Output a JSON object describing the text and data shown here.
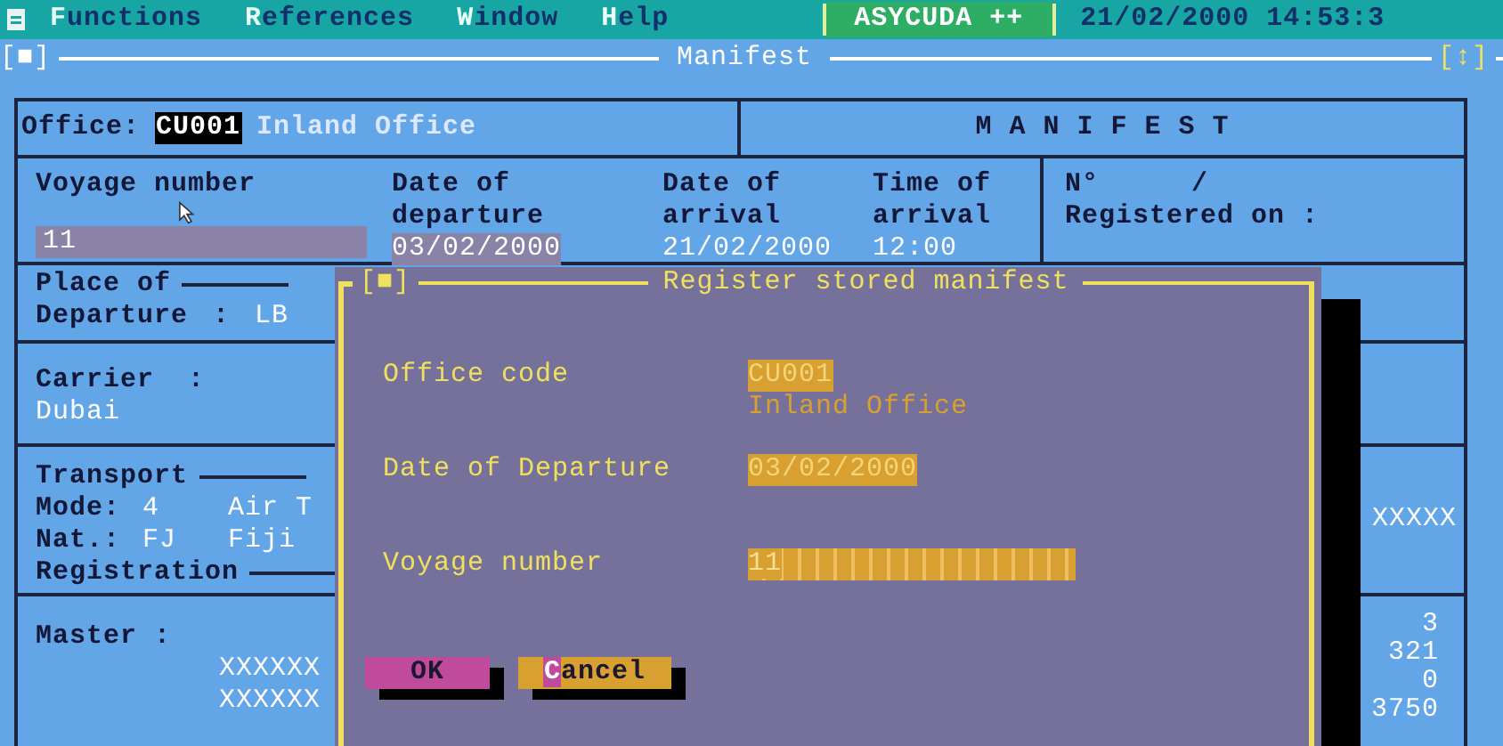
{
  "menu_bar": {
    "items": [
      {
        "label": "Functions"
      },
      {
        "label": "References"
      },
      {
        "label": "Window"
      },
      {
        "label": "Help"
      }
    ],
    "app_name": "ASYCUDA ++",
    "datetime": "21/02/2000 14:53:3"
  },
  "window": {
    "title": "Manifest",
    "left_control": "[■]",
    "right_control": "[↕]"
  },
  "header": {
    "office_label": "Office:",
    "office_code": "CU001",
    "office_name": "Inland Office",
    "form_title": "M A N I F E S T"
  },
  "voyage": {
    "columns": [
      {
        "label_lines": [
          "Voyage number"
        ],
        "value": "11",
        "kind": "field"
      },
      {
        "label_lines": [
          "Date of",
          "departure"
        ],
        "value": "03/02/2000",
        "kind": "field"
      },
      {
        "label_lines": [
          "Date of",
          "arrival"
        ],
        "value": "21/02/2000",
        "kind": "text"
      },
      {
        "label_lines": [
          "Time of",
          "arrival"
        ],
        "value": "12:00",
        "kind": "text"
      }
    ],
    "registration": {
      "number_label": "N°",
      "separator": "/",
      "registered_label": "Registered on :"
    }
  },
  "place_of_departure": {
    "legend": "Place of",
    "label": "Departure",
    "colon": ":",
    "value": "LB"
  },
  "carrier": {
    "label": "Carrier  :",
    "value": "Dubai"
  },
  "transport": {
    "legend": "Transport",
    "mode_label": "Mode:",
    "mode_code": "4",
    "mode_name": "Air T",
    "nationality_label": "Nat.:",
    "nationality_code": "FJ",
    "nationality_name": "Fiji",
    "registration_legend": "Registration",
    "registration_value": "XXXXX"
  },
  "master": {
    "label": "Master :",
    "lines": [
      "XXXXXX",
      "XXXXXX"
    ]
  },
  "totals": [
    "3",
    "321",
    "0",
    "3750"
  ],
  "dialog": {
    "control": "[■]",
    "title": "Register stored manifest",
    "fields": [
      {
        "label": "Office code",
        "value": "CU001",
        "detail": "Inland Office"
      },
      {
        "label": "Date of Departure",
        "value": "03/02/2000"
      },
      {
        "label": "Voyage number",
        "value": "11",
        "kind": "long"
      }
    ],
    "buttons": [
      {
        "label": "OK",
        "kind": "primary"
      },
      {
        "label": "Cancel",
        "kind": "hotkey"
      }
    ]
  }
}
